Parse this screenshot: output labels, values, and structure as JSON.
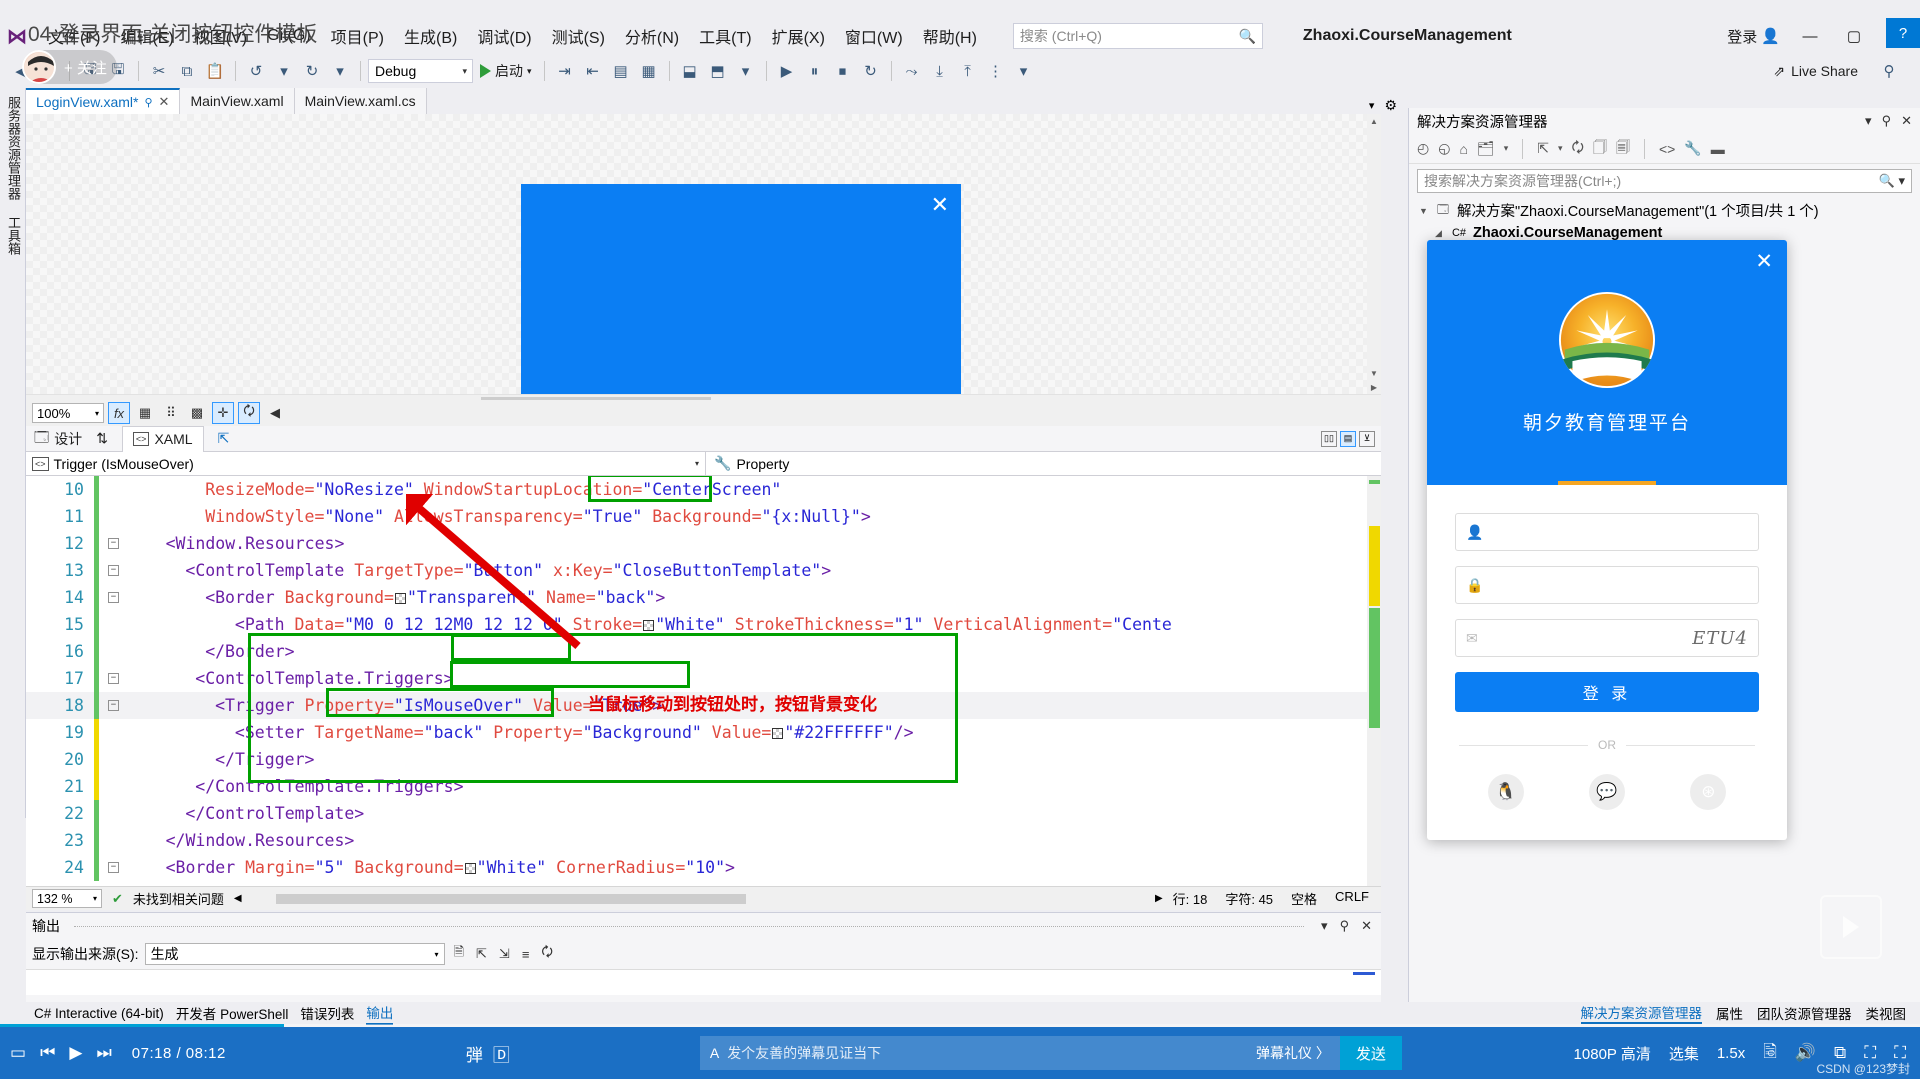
{
  "video": {
    "title": "04-登录界面-关闭按钮控件模板",
    "follow_label": "+ 关注",
    "time_current": "07:18",
    "time_total": "08:12",
    "time_display": "07:18 / 08:12",
    "danmu_placeholder": "发个友善的弹幕见证当下",
    "gift_label": "弹幕礼仪 〉",
    "send_label": "发送",
    "quality": "1080P 高清",
    "episodes": "选集",
    "speed": "1.5x",
    "watermark": "CSDN @123梦封"
  },
  "titlebar": {
    "menus": [
      "文件(F)",
      "编辑(E)",
      "视图(V)",
      "Git(G)",
      "项目(P)",
      "生成(B)",
      "调试(D)",
      "测试(S)",
      "分析(N)",
      "工具(T)",
      "扩展(X)",
      "窗口(W)",
      "帮助(H)"
    ],
    "search_placeholder": "搜索 (Ctrl+Q)",
    "solution_name": "Zhaoxi.CourseManagement",
    "signin_label": "登录",
    "minimize": "—",
    "maximize": "▢",
    "close": "✕",
    "help_badge": "?"
  },
  "toolbar": {
    "config": "Debug",
    "run_label": "启动",
    "live_share": "Live Share"
  },
  "left_rail": {
    "items": [
      "服务器资源管理器",
      "工具箱"
    ]
  },
  "doc_tabs": {
    "tabs": [
      {
        "label": "LoginView.xaml*",
        "active": true,
        "modified": "✕"
      },
      {
        "label": "MainView.xaml",
        "active": false
      },
      {
        "label": "MainView.xaml.cs",
        "active": false
      }
    ]
  },
  "designer": {
    "zoom": "100%",
    "design_label": "设计",
    "xaml_label": "XAML",
    "swap_icon": "⇅",
    "preview_close_icon": "✕"
  },
  "navbar": {
    "element": "Trigger (IsMouseOver)",
    "property_label": "Property"
  },
  "code": {
    "lines": [
      {
        "num": "10",
        "fold": "",
        "change": "green",
        "indent": 8,
        "segments": [
          {
            "t": "ResizeMode=",
            "c": "attr"
          },
          {
            "t": "\"NoResize\"",
            "c": "val"
          },
          {
            "t": " ",
            "c": "blk"
          },
          {
            "t": "WindowStartupLocation=",
            "c": "attr"
          },
          {
            "t": "\"CenterScreen\"",
            "c": "val"
          }
        ]
      },
      {
        "num": "11",
        "fold": "",
        "change": "green",
        "indent": 8,
        "segments": [
          {
            "t": "WindowStyle=",
            "c": "attr"
          },
          {
            "t": "\"None\"",
            "c": "val"
          },
          {
            "t": " ",
            "c": "blk"
          },
          {
            "t": "AllowsTransparency=",
            "c": "attr"
          },
          {
            "t": "\"True\"",
            "c": "val"
          },
          {
            "t": " ",
            "c": "blk"
          },
          {
            "t": "Background=",
            "c": "attr"
          },
          {
            "t": "\"{x:Null}\"",
            "c": "val"
          },
          {
            "t": ">",
            "c": "tag"
          }
        ]
      },
      {
        "num": "12",
        "fold": "−",
        "change": "green",
        "indent": 4,
        "segments": [
          {
            "t": "<Window.Resources>",
            "c": "tag"
          }
        ]
      },
      {
        "num": "13",
        "fold": "−",
        "change": "green",
        "indent": 6,
        "segments": [
          {
            "t": "<ControlTemplate ",
            "c": "tag"
          },
          {
            "t": "TargetType=",
            "c": "attr"
          },
          {
            "t": "\"Button\"",
            "c": "val"
          },
          {
            "t": " ",
            "c": "blk"
          },
          {
            "t": "x:Key=",
            "c": "attr"
          },
          {
            "t": "\"CloseButtonTemplate\"",
            "c": "val"
          },
          {
            "t": ">",
            "c": "tag"
          }
        ]
      },
      {
        "num": "14",
        "fold": "−",
        "change": "green",
        "indent": 8,
        "segments": [
          {
            "t": "<Border ",
            "c": "tag"
          },
          {
            "t": "Background=",
            "c": "attr"
          },
          {
            "t": "SWATCH",
            "c": "sw"
          },
          {
            "t": "\"Transparent\"",
            "c": "val"
          },
          {
            "t": " ",
            "c": "blk"
          },
          {
            "t": "Name=",
            "c": "attr"
          },
          {
            "t": "\"back\"",
            "c": "val"
          },
          {
            "t": ">",
            "c": "tag"
          }
        ]
      },
      {
        "num": "15",
        "fold": "",
        "change": "green",
        "indent": 11,
        "segments": [
          {
            "t": "<Path ",
            "c": "tag"
          },
          {
            "t": "Data=",
            "c": "attr"
          },
          {
            "t": "\"M0 0 12 12M0 12 12 0\"",
            "c": "val"
          },
          {
            "t": " ",
            "c": "blk"
          },
          {
            "t": "Stroke=",
            "c": "attr"
          },
          {
            "t": "SWATCH",
            "c": "sw"
          },
          {
            "t": "\"White\"",
            "c": "val"
          },
          {
            "t": " ",
            "c": "blk"
          },
          {
            "t": "StrokeThickness=",
            "c": "attr"
          },
          {
            "t": "\"1\"",
            "c": "val"
          },
          {
            "t": " ",
            "c": "blk"
          },
          {
            "t": "VerticalAlignment=",
            "c": "attr"
          },
          {
            "t": "\"Cente",
            "c": "val"
          }
        ]
      },
      {
        "num": "16",
        "fold": "",
        "change": "green",
        "indent": 8,
        "segments": [
          {
            "t": "</Border>",
            "c": "tag"
          }
        ]
      },
      {
        "num": "17",
        "fold": "−",
        "change": "green",
        "indent": 7,
        "segments": [
          {
            "t": "<ControlTemplate.Triggers>",
            "c": "tag"
          }
        ]
      },
      {
        "num": "18",
        "fold": "−",
        "change": "green",
        "indent": 9,
        "segments": [
          {
            "t": "<Trigger ",
            "c": "tag"
          },
          {
            "t": "Property=",
            "c": "attr"
          },
          {
            "t": "\"IsMouseOver\"",
            "c": "val"
          },
          {
            "t": " ",
            "c": "blk"
          },
          {
            "t": "Value=",
            "c": "attr"
          },
          {
            "t": "\"True\"",
            "c": "val"
          },
          {
            "t": ">",
            "c": "tag"
          }
        ]
      },
      {
        "num": "19",
        "fold": "",
        "change": "yellow",
        "indent": 11,
        "segments": [
          {
            "t": "<Setter ",
            "c": "tag"
          },
          {
            "t": "TargetName=",
            "c": "attr"
          },
          {
            "t": "\"back\"",
            "c": "val"
          },
          {
            "t": " ",
            "c": "blk"
          },
          {
            "t": "Property=",
            "c": "attr"
          },
          {
            "t": "\"Background\"",
            "c": "val"
          },
          {
            "t": " ",
            "c": "blk"
          },
          {
            "t": "Value=",
            "c": "attr"
          },
          {
            "t": "SWATCH",
            "c": "sw"
          },
          {
            "t": "\"#22FFFFFF\"",
            "c": "val"
          },
          {
            "t": "/>",
            "c": "tag"
          }
        ]
      },
      {
        "num": "20",
        "fold": "",
        "change": "yellow",
        "indent": 9,
        "segments": [
          {
            "t": "</Trigger>",
            "c": "tag"
          }
        ]
      },
      {
        "num": "21",
        "fold": "",
        "change": "yellow",
        "indent": 7,
        "segments": [
          {
            "t": "</ControlTemplate.Triggers>",
            "c": "tag"
          }
        ]
      },
      {
        "num": "22",
        "fold": "",
        "change": "green",
        "indent": 6,
        "segments": [
          {
            "t": "</ControlTemplate>",
            "c": "tag"
          }
        ]
      },
      {
        "num": "23",
        "fold": "",
        "change": "green",
        "indent": 4,
        "segments": [
          {
            "t": "</Window.Resources>",
            "c": "tag"
          }
        ]
      },
      {
        "num": "24",
        "fold": "−",
        "change": "green",
        "indent": 4,
        "segments": [
          {
            "t": "<Border ",
            "c": "tag"
          },
          {
            "t": "Margin=",
            "c": "attr"
          },
          {
            "t": "\"5\"",
            "c": "val"
          },
          {
            "t": " ",
            "c": "blk"
          },
          {
            "t": "Background=",
            "c": "attr"
          },
          {
            "t": "SWATCH",
            "c": "sw"
          },
          {
            "t": "\"White\"",
            "c": "val"
          },
          {
            "t": " ",
            "c": "blk"
          },
          {
            "t": "CornerRadius=",
            "c": "attr"
          },
          {
            "t": "\"10\"",
            "c": "val"
          },
          {
            "t": ">",
            "c": "tag"
          }
        ]
      }
    ],
    "annotation": "当鼠标移动到按钮处时，按钮背景变化"
  },
  "editor_status": {
    "zoom": "132 %",
    "problems": "未找到相关问题",
    "line": "行: 18",
    "col": "字符: 45",
    "spaces": "空格",
    "eol": "CRLF"
  },
  "output": {
    "title": "输出",
    "source_label": "显示输出来源(S):",
    "source_value": "生成"
  },
  "dock_tabs": {
    "left": [
      "C# Interactive (64-bit)",
      "开发者 PowerShell",
      "错误列表",
      "输出"
    ],
    "left_active": "输出",
    "right": [
      "解决方案资源管理器",
      "属性",
      "团队资源管理器",
      "类视图"
    ],
    "right_active": "解决方案资源管理器"
  },
  "solution_explorer": {
    "title": "解决方案资源管理器",
    "search_placeholder": "搜索解决方案资源管理器(Ctrl+;)",
    "solution_row": "解决方案\"Zhaoxi.CourseManagement\"(1 个项目/共 1 个)",
    "project_row": "Zhaoxi.CourseManagement"
  },
  "login_window": {
    "title": "朝夕教育管理平台",
    "close_icon": "✕",
    "user_placeholder": "",
    "password_placeholder": "",
    "captcha_value": "ETU4",
    "login_button": "登 录",
    "or_label": "OR",
    "socials": [
      "qq-icon",
      "wechat-icon",
      "weibo-icon"
    ]
  },
  "colors": {
    "accent_blue": "#0b7ef3",
    "annotation_green": "#00a000",
    "annotation_red": "#e00000",
    "player_blue": "#1b6fc4",
    "send_blue": "#00a1d6"
  }
}
